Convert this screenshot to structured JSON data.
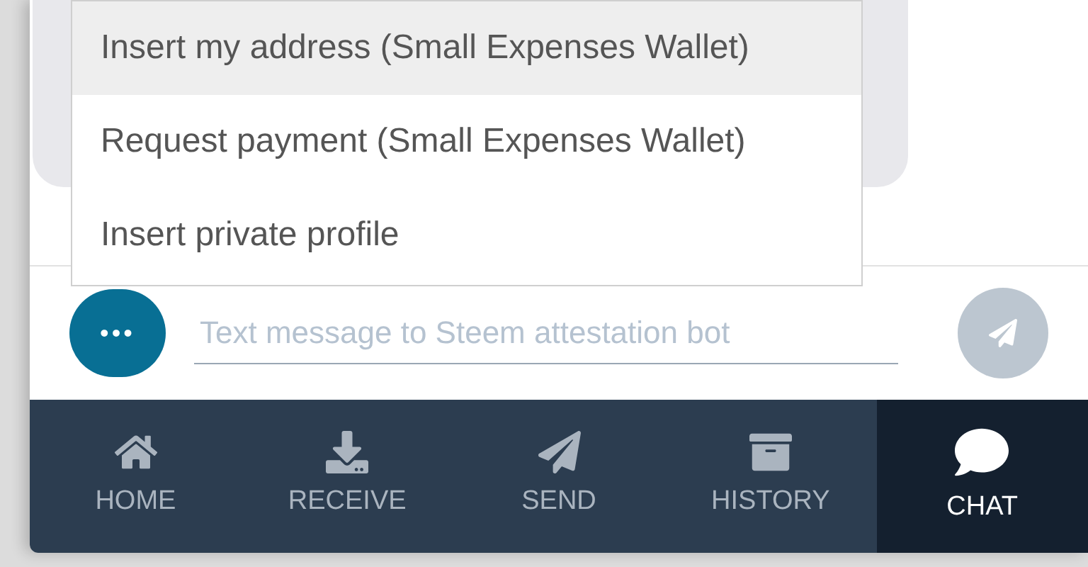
{
  "menu": [
    {
      "label": "Insert my address (Small Expenses Wallet)",
      "selected": true
    },
    {
      "label": "Request payment (Small Expenses Wallet)",
      "selected": false
    },
    {
      "label": "Insert private profile",
      "selected": false
    }
  ],
  "composer": {
    "more_button": "•••",
    "placeholder": "Text message to Steem attestation bot"
  },
  "nav": [
    {
      "label": "HOME",
      "kind": "home",
      "selected": false
    },
    {
      "label": "RECEIVE",
      "kind": "receive",
      "selected": false
    },
    {
      "label": "SEND",
      "kind": "send",
      "selected": false
    },
    {
      "label": "HISTORY",
      "kind": "history",
      "selected": false
    },
    {
      "label": "CHAT",
      "kind": "chat",
      "selected": true
    }
  ]
}
